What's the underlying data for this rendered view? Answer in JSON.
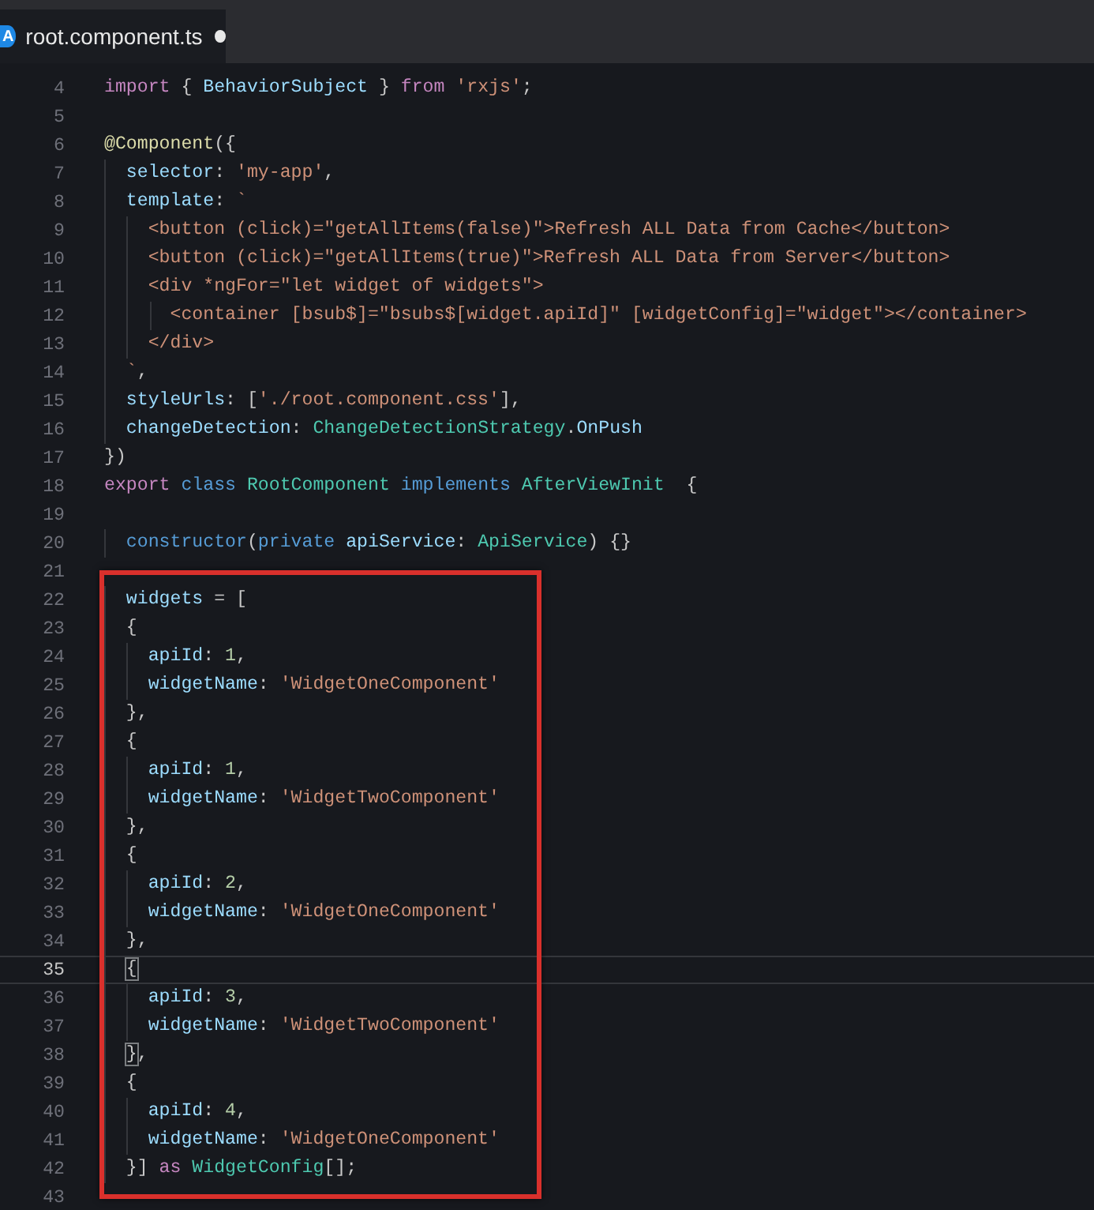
{
  "tab": {
    "icon_text": "A",
    "title": "root.component.ts",
    "modified": true
  },
  "editor": {
    "lines_before": [
      {
        "number": "4",
        "current": false,
        "tokens": [
          {
            "kind": "keyword",
            "text": "import"
          },
          {
            "kind": "plain",
            "text": " { "
          },
          {
            "kind": "variable",
            "text": "BehaviorSubject"
          },
          {
            "kind": "plain",
            "text": " } "
          },
          {
            "kind": "keyword",
            "text": "from"
          },
          {
            "kind": "string",
            "text": " 'rxjs'"
          },
          {
            "kind": "plain",
            "text": ";"
          }
        ]
      },
      {
        "number": "5",
        "current": false
      },
      {
        "number": "6",
        "current": false,
        "tokens": [
          {
            "kind": "function",
            "text": "@Component"
          },
          {
            "kind": "plain",
            "text": "({"
          }
        ]
      },
      {
        "number": "7",
        "current": false,
        "tokens": [
          {
            "kind": "variable",
            "text": "  selector"
          },
          {
            "kind": "plain",
            "text": ": "
          },
          {
            "kind": "string",
            "text": "'my-app'"
          },
          {
            "kind": "plain",
            "text": ","
          }
        ]
      },
      {
        "number": "8",
        "current": false,
        "tokens": [
          {
            "kind": "variable",
            "text": "  template"
          },
          {
            "kind": "plain",
            "text": ": "
          },
          {
            "kind": "string",
            "text": "`"
          }
        ]
      },
      {
        "number": "9",
        "current": false,
        "tokens": [
          {
            "kind": "string",
            "text": "    <button (click)=\"getAllItems(false)\">Refresh ALL Data from Cache</button>"
          }
        ]
      },
      {
        "number": "10",
        "current": false,
        "tokens": [
          {
            "kind": "string",
            "text": "    <button (click)=\"getAllItems(true)\">Refresh ALL Data from Server</button>"
          }
        ]
      },
      {
        "number": "11",
        "current": false,
        "tokens": [
          {
            "kind": "string",
            "text": "    <div *ngFor=\"let widget of widgets\">"
          }
        ]
      },
      {
        "number": "12",
        "current": false,
        "tokens": [
          {
            "kind": "string",
            "text": "      <container [bsub$]=\"bsubs$[widget.apiId]\" [widgetConfig]=\"widget\"></container>"
          }
        ]
      },
      {
        "number": "13",
        "current": false,
        "tokens": [
          {
            "kind": "string",
            "text": "    </div>"
          }
        ]
      },
      {
        "number": "14",
        "current": false,
        "tokens": [
          {
            "kind": "string",
            "text": "  `"
          },
          {
            "kind": "plain",
            "text": ","
          }
        ]
      },
      {
        "number": "15",
        "current": false,
        "tokens": [
          {
            "kind": "variable",
            "text": "  styleUrls"
          },
          {
            "kind": "plain",
            "text": ": ["
          },
          {
            "kind": "string",
            "text": "'./root.component.css'"
          },
          {
            "kind": "plain",
            "text": "],"
          }
        ]
      },
      {
        "number": "16",
        "current": false,
        "tokens": [
          {
            "kind": "variable",
            "text": "  changeDetection"
          },
          {
            "kind": "plain",
            "text": ": "
          },
          {
            "kind": "type",
            "text": "ChangeDetectionStrategy"
          },
          {
            "kind": "plain",
            "text": "."
          },
          {
            "kind": "variable",
            "text": "OnPush"
          }
        ]
      },
      {
        "number": "17",
        "current": false,
        "tokens": [
          {
            "kind": "plain",
            "text": "})"
          }
        ]
      },
      {
        "number": "18",
        "current": false,
        "tokens": [
          {
            "kind": "keyword",
            "text": "export"
          },
          {
            "kind": "storage",
            "text": " class"
          },
          {
            "kind": "type",
            "text": " RootComponent"
          },
          {
            "kind": "storage",
            "text": " implements"
          },
          {
            "kind": "type",
            "text": " AfterViewInit"
          },
          {
            "kind": "plain",
            "text": "  {"
          }
        ]
      },
      {
        "number": "19",
        "current": false
      },
      {
        "number": "20",
        "current": false,
        "tokens": [
          {
            "kind": "storage",
            "text": "  constructor"
          },
          {
            "kind": "plain",
            "text": "("
          },
          {
            "kind": "storage",
            "text": "private"
          },
          {
            "kind": "variable",
            "text": " apiService"
          },
          {
            "kind": "plain",
            "text": ": "
          },
          {
            "kind": "type",
            "text": "ApiService"
          },
          {
            "kind": "plain",
            "text": ") {}"
          }
        ]
      },
      {
        "number": "21",
        "current": false
      }
    ],
    "highlighted_block": {
      "lines": [
        {
          "number": "22",
          "current": false,
          "tokens": [
            {
              "kind": "variable",
              "text": "  widgets"
            },
            {
              "kind": "plain",
              "text": " = ["
            }
          ]
        },
        {
          "number": "23",
          "current": false,
          "tokens": [
            {
              "kind": "plain",
              "text": "  {"
            }
          ]
        },
        {
          "number": "24",
          "current": false,
          "tokens": [
            {
              "kind": "variable",
              "text": "    apiId"
            },
            {
              "kind": "plain",
              "text": ": "
            },
            {
              "kind": "number",
              "text": "1"
            },
            {
              "kind": "plain",
              "text": ","
            }
          ]
        },
        {
          "number": "25",
          "current": false,
          "tokens": [
            {
              "kind": "variable",
              "text": "    widgetName"
            },
            {
              "kind": "plain",
              "text": ": "
            },
            {
              "kind": "string",
              "text": "'WidgetOneComponent'"
            }
          ]
        },
        {
          "number": "26",
          "current": false,
          "tokens": [
            {
              "kind": "plain",
              "text": "  },"
            }
          ]
        },
        {
          "number": "27",
          "current": false,
          "tokens": [
            {
              "kind": "plain",
              "text": "  {"
            }
          ]
        },
        {
          "number": "28",
          "current": false,
          "tokens": [
            {
              "kind": "variable",
              "text": "    apiId"
            },
            {
              "kind": "plain",
              "text": ": "
            },
            {
              "kind": "number",
              "text": "1"
            },
            {
              "kind": "plain",
              "text": ","
            }
          ]
        },
        {
          "number": "29",
          "current": false,
          "tokens": [
            {
              "kind": "variable",
              "text": "    widgetName"
            },
            {
              "kind": "plain",
              "text": ": "
            },
            {
              "kind": "string",
              "text": "'WidgetTwoComponent'"
            }
          ]
        },
        {
          "number": "30",
          "current": false,
          "tokens": [
            {
              "kind": "plain",
              "text": "  },"
            }
          ]
        },
        {
          "number": "31",
          "current": false,
          "tokens": [
            {
              "kind": "plain",
              "text": "  {"
            }
          ]
        },
        {
          "number": "32",
          "current": false,
          "tokens": [
            {
              "kind": "variable",
              "text": "    apiId"
            },
            {
              "kind": "plain",
              "text": ": "
            },
            {
              "kind": "number",
              "text": "2"
            },
            {
              "kind": "plain",
              "text": ","
            }
          ]
        },
        {
          "number": "33",
          "current": false,
          "tokens": [
            {
              "kind": "variable",
              "text": "    widgetName"
            },
            {
              "kind": "plain",
              "text": ": "
            },
            {
              "kind": "string",
              "text": "'WidgetOneComponent'"
            }
          ]
        },
        {
          "number": "34",
          "current": false,
          "tokens": [
            {
              "kind": "plain",
              "text": "  },"
            }
          ]
        },
        {
          "number": "35",
          "current": true,
          "tokens": [
            {
              "kind": "bracket_match",
              "text": "  {"
            }
          ]
        },
        {
          "number": "36",
          "current": false,
          "tokens": [
            {
              "kind": "variable",
              "text": "    apiId"
            },
            {
              "kind": "plain",
              "text": ": "
            },
            {
              "kind": "number",
              "text": "3"
            },
            {
              "kind": "plain",
              "text": ","
            }
          ]
        },
        {
          "number": "37",
          "current": false,
          "tokens": [
            {
              "kind": "variable",
              "text": "    widgetName"
            },
            {
              "kind": "plain",
              "text": ": "
            },
            {
              "kind": "string",
              "text": "'WidgetTwoComponent'"
            }
          ]
        },
        {
          "number": "38",
          "current": false,
          "tokens": [
            {
              "kind": "bracket_match",
              "text": "  }"
            },
            {
              "kind": "plain",
              "text": ","
            }
          ]
        },
        {
          "number": "39",
          "current": false,
          "tokens": [
            {
              "kind": "plain",
              "text": "  {"
            }
          ]
        },
        {
          "number": "40",
          "current": false,
          "tokens": [
            {
              "kind": "variable",
              "text": "    apiId"
            },
            {
              "kind": "plain",
              "text": ": "
            },
            {
              "kind": "number",
              "text": "4"
            },
            {
              "kind": "plain",
              "text": ","
            }
          ]
        },
        {
          "number": "41",
          "current": false,
          "tokens": [
            {
              "kind": "variable",
              "text": "    widgetName"
            },
            {
              "kind": "plain",
              "text": ": "
            },
            {
              "kind": "string",
              "text": "'WidgetOneComponent'"
            }
          ]
        },
        {
          "number": "42",
          "current": false,
          "tokens": [
            {
              "kind": "plain",
              "text": "  }] "
            },
            {
              "kind": "keyword",
              "text": "as"
            },
            {
              "kind": "type",
              "text": " WidgetConfig"
            },
            {
              "kind": "plain",
              "text": "[];"
            }
          ]
        }
      ]
    },
    "lines_after": [
      {
        "number": "43",
        "current": false
      }
    ]
  }
}
